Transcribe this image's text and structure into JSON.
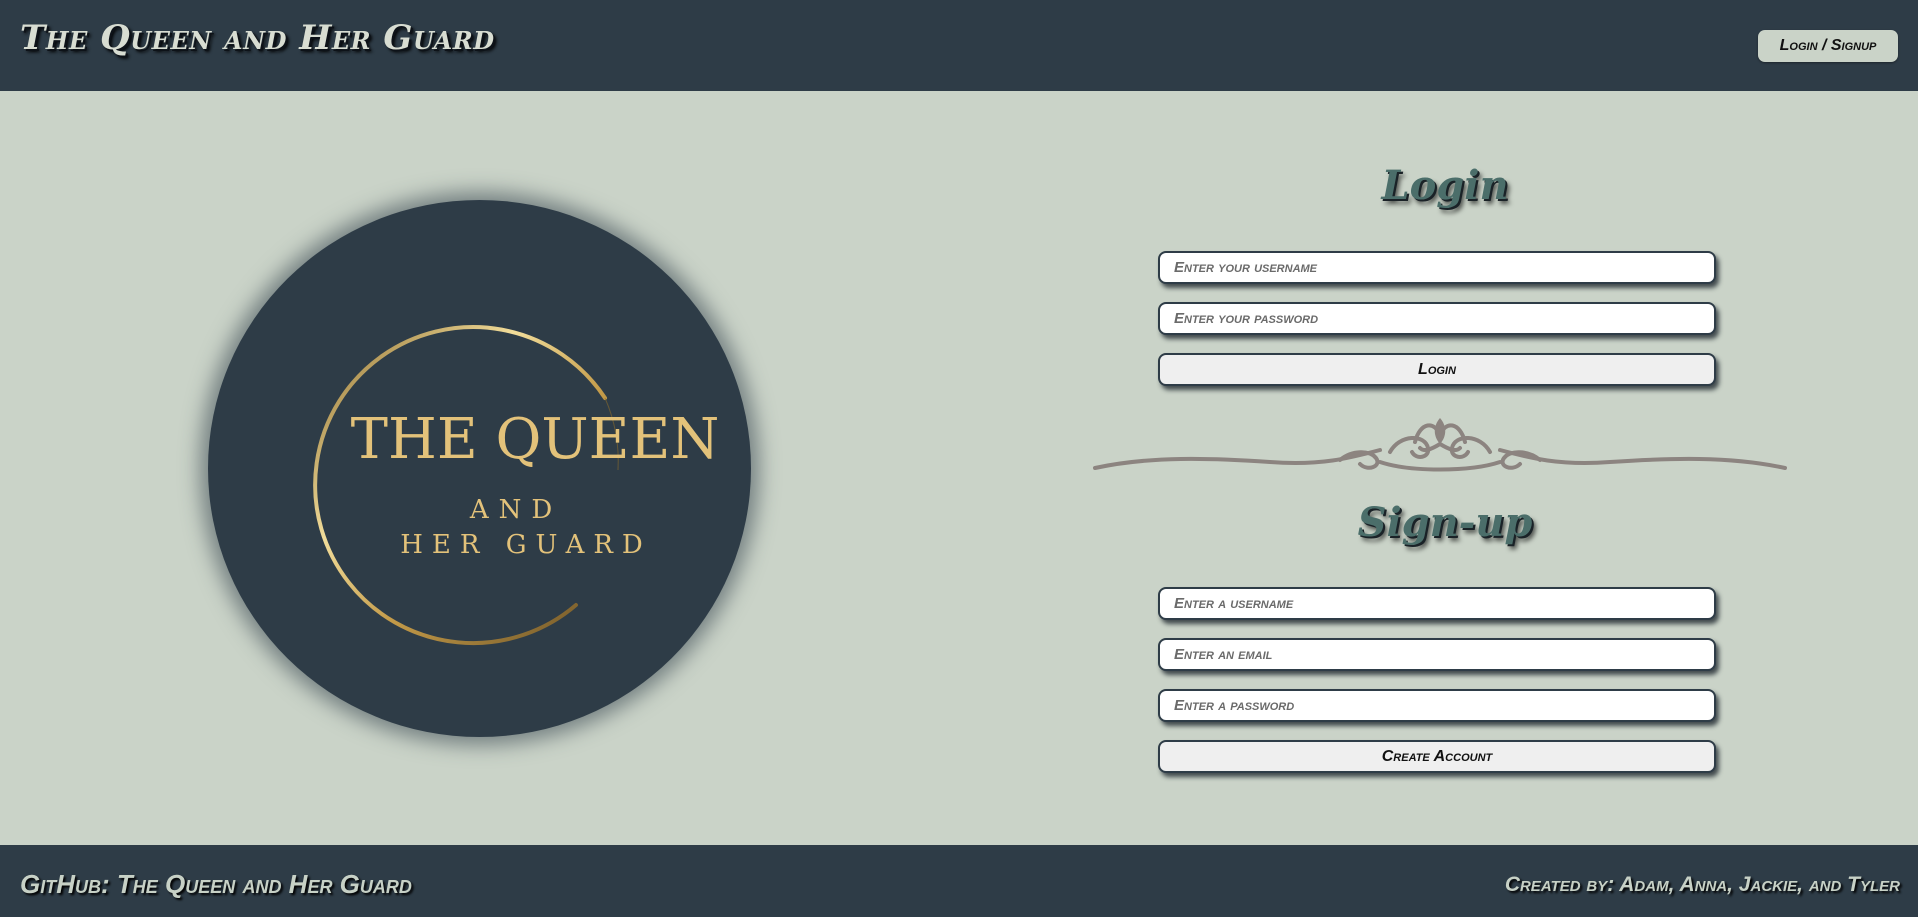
{
  "header": {
    "title": "The Queen and Her Guard",
    "nav_button": "Login / Signup"
  },
  "logo": {
    "line1": "THE QUEEN",
    "line2": "AND",
    "line3": "HER GUARD",
    "colors": {
      "background": "#2e3c47",
      "gold": "#e3c27a"
    }
  },
  "login": {
    "title": "Login",
    "username_placeholder": "Enter your username",
    "password_placeholder": "Enter your password",
    "submit_label": "Login"
  },
  "signup": {
    "title": "Sign-up",
    "username_placeholder": "Enter a username",
    "email_placeholder": "Enter an email",
    "password_placeholder": "Enter a password",
    "submit_label": "Create Account"
  },
  "footer": {
    "github_link": "GitHub: The Queen and Her Guard",
    "credits": "Created by: Adam, Anna, Jackie, and Tyler"
  },
  "colors": {
    "background": "#cad3c8",
    "header_footer": "#2e3c47",
    "title_accent": "#4b6e6a",
    "divider": "#8c8480"
  },
  "icons": {
    "divider": "ornamental-fleur-de-lis-divider"
  }
}
